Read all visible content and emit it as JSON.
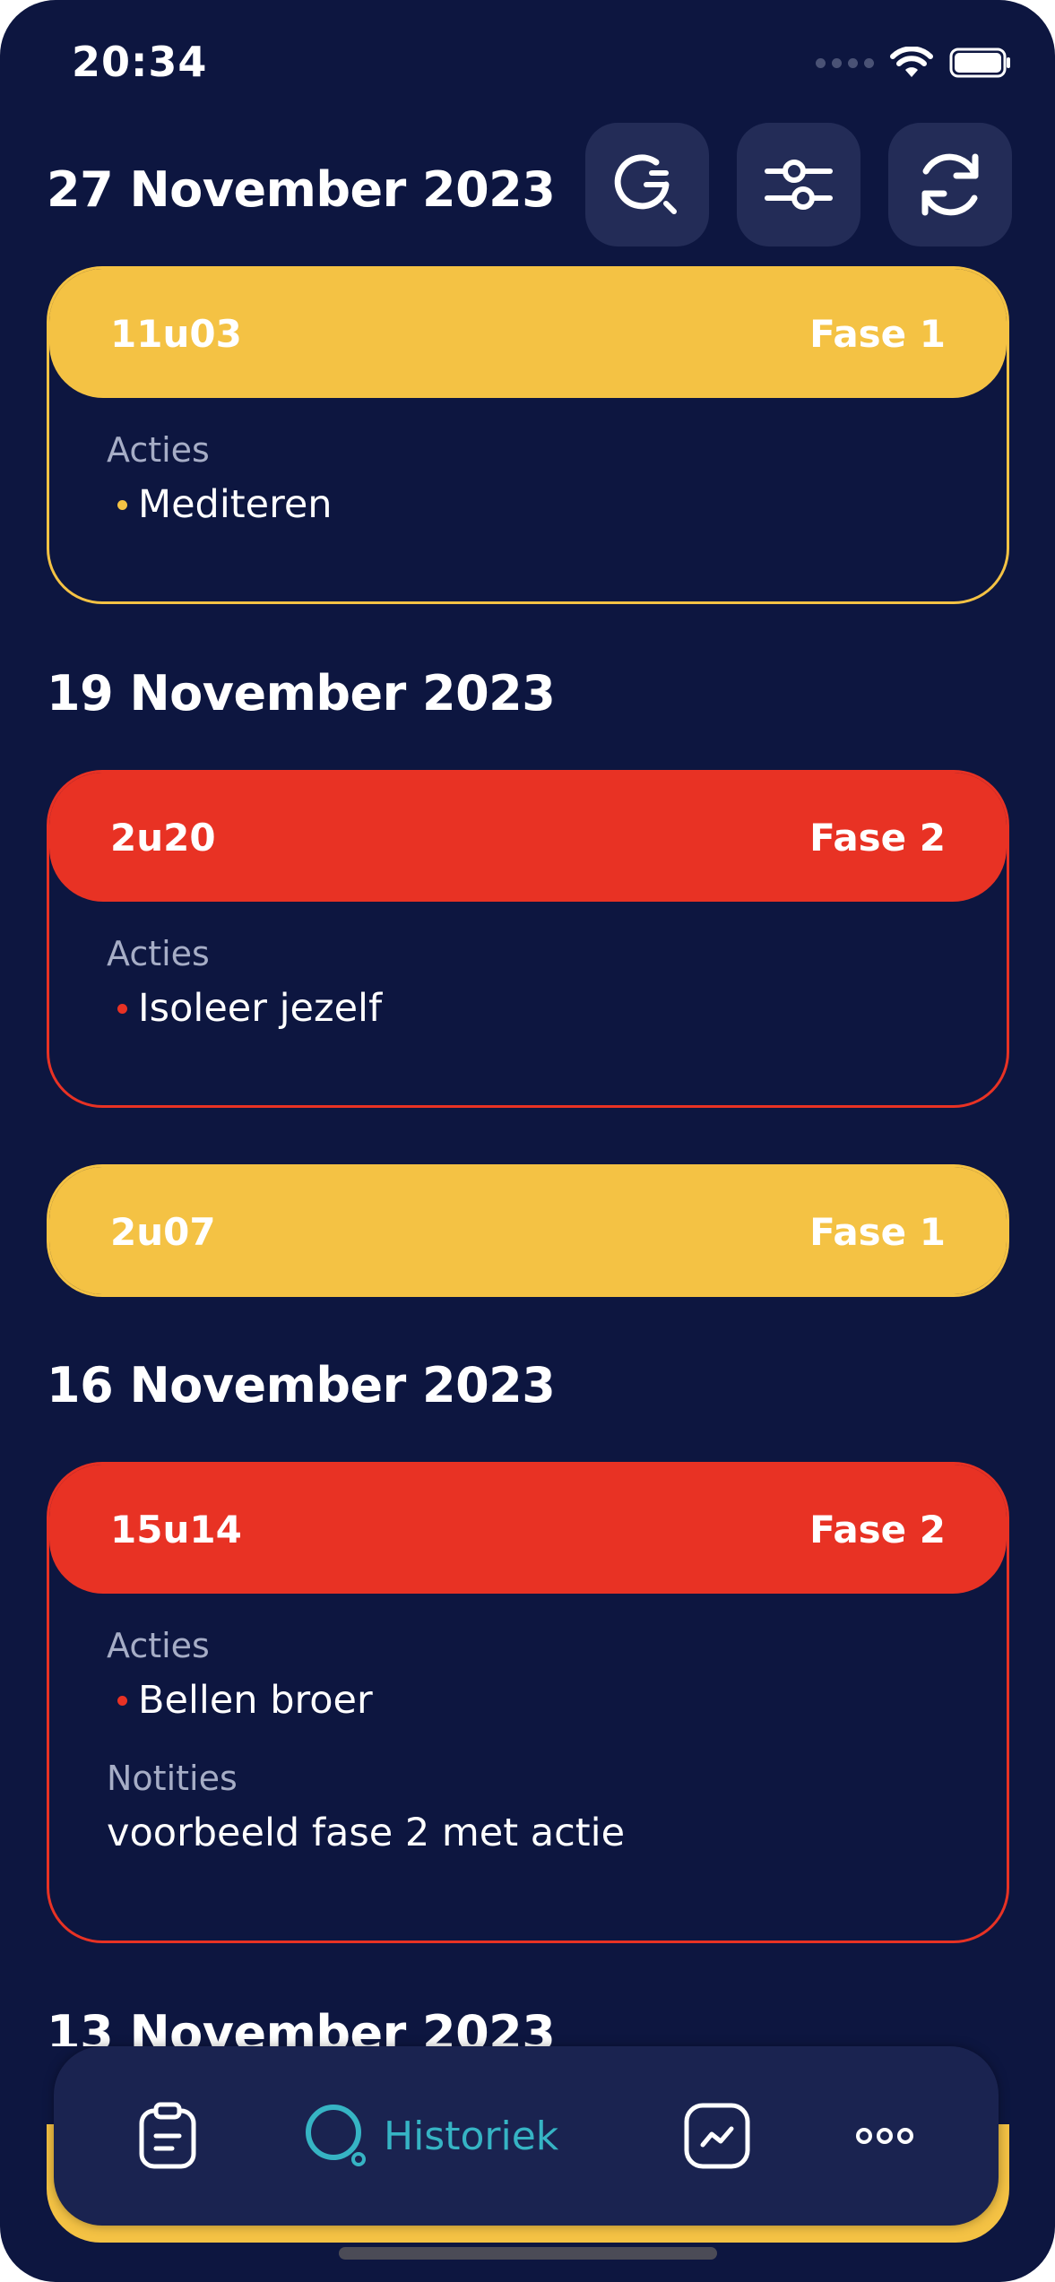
{
  "status_bar": {
    "time": "20:34"
  },
  "sections": [
    {
      "date": "27 November 2023"
    },
    {
      "date": "19 November 2023"
    },
    {
      "date": "16 November 2023"
    },
    {
      "date": "13 November 2023"
    }
  ],
  "cards": [
    {
      "time": "11u03",
      "phase": "Fase 1",
      "actions_label": "Acties",
      "actions": [
        "Mediteren"
      ]
    },
    {
      "time": "2u20",
      "phase": "Fase 2",
      "actions_label": "Acties",
      "actions": [
        "Isoleer jezelf"
      ]
    },
    {
      "time": "2u07",
      "phase": "Fase 1"
    },
    {
      "time": "15u14",
      "phase": "Fase 2",
      "actions_label": "Acties",
      "actions": [
        "Bellen broer"
      ],
      "notes_label": "Notities",
      "notes": "voorbeeld fase 2 met actie"
    }
  ],
  "tab_bar": {
    "active_label": "Historiek"
  },
  "colors": {
    "background": "#0d1640",
    "phase1": "#f4c244",
    "phase2": "#e83224",
    "accent": "#36b4c4"
  },
  "icons": [
    "search-history-icon",
    "filter-sliders-icon",
    "refresh-icon",
    "clipboard-icon",
    "history-search-icon",
    "chart-icon",
    "more-icon"
  ]
}
